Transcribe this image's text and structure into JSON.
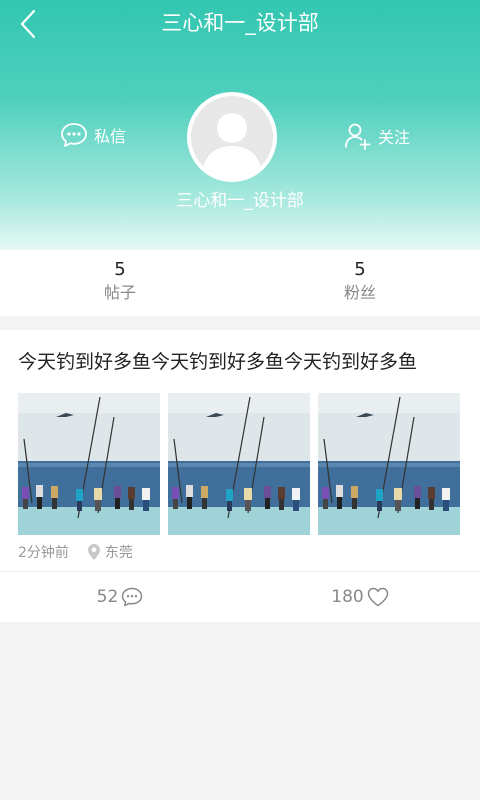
{
  "header": {
    "title": "三心和一_设计部",
    "back_icon": "chevron-left-icon",
    "message_label": "私信",
    "message_icon": "chat-bubble-icon",
    "follow_label": "关注",
    "follow_icon": "user-add-icon",
    "user_name": "三心和一_设计部",
    "gradient": [
      "#32c6b1",
      "#e6f8f5"
    ]
  },
  "stats": [
    {
      "value": "5",
      "label": "帖子"
    },
    {
      "value": "5",
      "label": "粉丝"
    }
  ],
  "post": {
    "title": "今天钓到好多鱼今天钓到好多鱼今天钓到好多鱼",
    "time": "2分钟前",
    "location": "东莞",
    "location_icon": "location-pin-icon",
    "comments": "52",
    "comment_icon": "comment-icon",
    "likes": "180",
    "like_icon": "heart-icon"
  }
}
